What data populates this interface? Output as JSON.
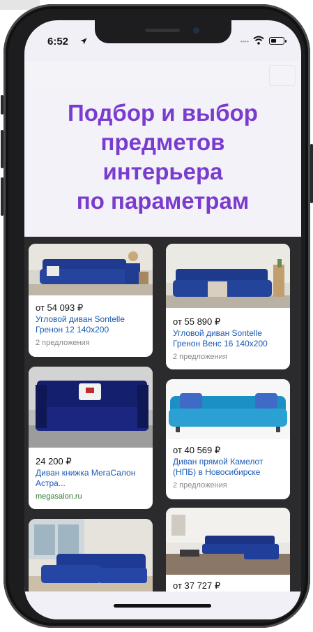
{
  "status": {
    "time": "6:52"
  },
  "headline": "Подбор и выбор\nпредметов\nинтерьера\nпо параметрам",
  "products": [
    {
      "price": "от 54 093 ₽",
      "title": "Угловой диван Sontelle Гренон 12 140x200",
      "offers": "2 предложения"
    },
    {
      "price": "от 55 890 ₽",
      "title": "Угловой диван Sontelle Гренон Венс 16 140x200",
      "offers": "2 предложения"
    },
    {
      "price": "24 200 ₽",
      "title": "Диван книжка МегаСалон Астра...",
      "shop": "megasalon.ru"
    },
    {
      "price": "от 40 569 ₽",
      "title": "Диван прямой Камелот (НПБ) в Новосибирске",
      "offers": "2 предложения"
    },
    {
      "price": "",
      "title": ""
    },
    {
      "price": "от 37 727 ₽",
      "title": ""
    }
  ],
  "colors": {
    "accent": "#7a3bcf",
    "link": "#1a5bb5",
    "shop": "#2f7a2f"
  }
}
